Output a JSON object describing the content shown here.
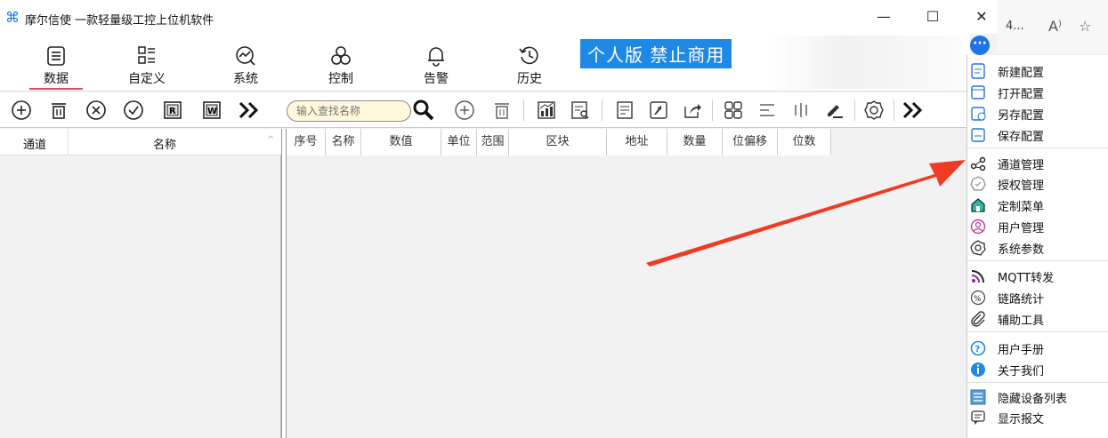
{
  "window": {
    "title": "摩尔信使  一款轻量级工控上位机软件",
    "minimize": "—",
    "maximize": "☐",
    "close": "✕"
  },
  "browser_edge": {
    "text": "4...",
    "read_aloud": "A⁾",
    "favorite": "☆"
  },
  "nav": {
    "items": [
      {
        "label": "数据"
      },
      {
        "label": "自定义"
      },
      {
        "label": "系统"
      },
      {
        "label": "控制"
      },
      {
        "label": "告警"
      },
      {
        "label": "历史"
      }
    ]
  },
  "banner": {
    "text": "个人版 禁止商用"
  },
  "search": {
    "placeholder": "输入查找名称"
  },
  "left_table": {
    "columns": [
      "通道",
      "名称"
    ]
  },
  "grid": {
    "columns": [
      "序号",
      "名称",
      "数值",
      "单位",
      "范围",
      "区块",
      "地址",
      "数量",
      "位偏移",
      "位数"
    ]
  },
  "menu": {
    "items": [
      {
        "label": "新建配置",
        "icon": "new-config-icon"
      },
      {
        "label": "打开配置",
        "icon": "open-config-icon"
      },
      {
        "label": "另存配置",
        "icon": "save-as-icon"
      },
      {
        "label": "保存配置",
        "icon": "save-icon"
      },
      {
        "label": "通道管理",
        "icon": "share-icon"
      },
      {
        "label": "授权管理",
        "icon": "authorize-icon"
      },
      {
        "label": "定制菜单",
        "icon": "home-icon"
      },
      {
        "label": "用户管理",
        "icon": "user-icon"
      },
      {
        "label": "系统参数",
        "icon": "gear-icon"
      },
      {
        "label": "MQTT转发",
        "icon": "rss-icon"
      },
      {
        "label": "链路统计",
        "icon": "percent-icon"
      },
      {
        "label": "辅助工具",
        "icon": "paperclip-icon"
      },
      {
        "label": "用户手册",
        "icon": "help-icon"
      },
      {
        "label": "关于我们",
        "icon": "info-icon"
      },
      {
        "label": "隐藏设备列表",
        "icon": "list-icon"
      },
      {
        "label": "显示报文",
        "icon": "message-icon"
      }
    ]
  }
}
